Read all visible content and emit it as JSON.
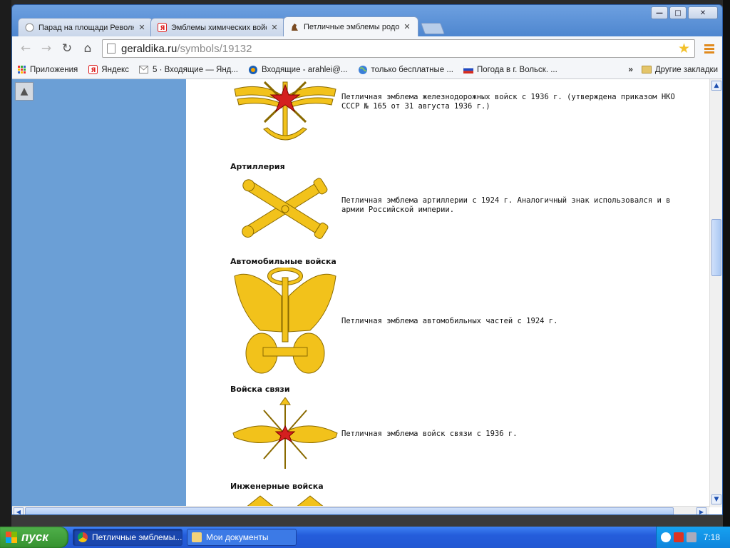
{
  "browser": {
    "tabs": [
      {
        "title": "Парад на площади Револю",
        "active": false
      },
      {
        "title": "Эмблемы химических войс",
        "active": false
      },
      {
        "title": "Петличные эмблемы родов",
        "active": true
      }
    ],
    "url": {
      "host": "geraldika.ru",
      "path": "/symbols/19132"
    },
    "window_buttons": {
      "minimize": "—",
      "maximize": "□",
      "close": "✕"
    }
  },
  "bookmarks": {
    "items": [
      {
        "label": "Приложения",
        "icon": "apps-icon"
      },
      {
        "label": "Яндекс",
        "icon": "yandex-icon"
      },
      {
        "label": "5 · Входящие — Янд...",
        "icon": "mail-icon"
      },
      {
        "label": "Входящие - arahlei@...",
        "icon": "mailru-icon"
      },
      {
        "label": "только бесплатные ...",
        "icon": "globe-icon"
      },
      {
        "label": "Погода в г. Вольск. ...",
        "icon": "flag-icon"
      }
    ],
    "more": "»",
    "other": "Другие закладки"
  },
  "page": {
    "sections": [
      {
        "heading": "",
        "desc": "Петличная эмблема железнодорожных войск с 1936 г. (утверждена приказом НКО СССР № 165 от 31 августа 1936 г.)"
      },
      {
        "heading": "Артиллерия",
        "desc": "Петличная эмблема артиллерии с 1924 г. Аналогичный знак использовался и в армии Российской империи."
      },
      {
        "heading": "Автомобильные войска",
        "desc": "Петличная эмблема автомобильных частей с 1924 г."
      },
      {
        "heading": "Войска связи",
        "desc": "Петличная эмблема войск связи с 1936 г."
      },
      {
        "heading": "Инженерные войска",
        "desc": ""
      }
    ]
  },
  "taskbar": {
    "start": "пуск",
    "items": [
      {
        "label": "Петличные эмблемы...",
        "active": true
      },
      {
        "label": "Мои документы",
        "active": false
      }
    ],
    "clock": "7:18"
  },
  "colors": {
    "gold": "#f2c21b",
    "gold_dark": "#8a6a00",
    "red": "#d41f1f",
    "side_panel": "#6b9fd6"
  }
}
